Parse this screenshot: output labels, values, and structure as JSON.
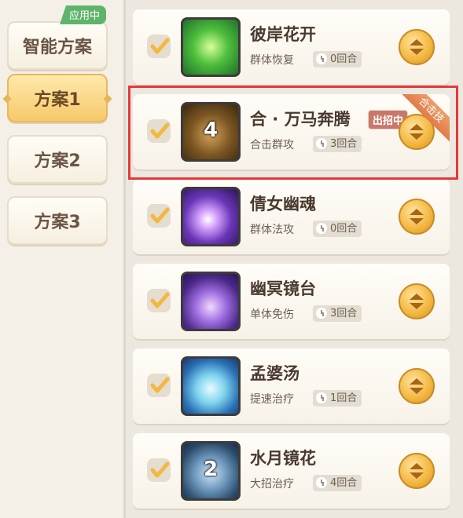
{
  "sidebar": {
    "plans": [
      {
        "label": "智能方案",
        "active": false,
        "badge": "应用中"
      },
      {
        "label": "方案1",
        "active": true
      },
      {
        "label": "方案2",
        "active": false
      },
      {
        "label": "方案3",
        "active": false
      }
    ]
  },
  "skills": [
    {
      "name": "彼岸花开",
      "type": "群体恢复",
      "rounds": "0回合",
      "icon": "green-flower-skill-icon",
      "colors": [
        "#2f8f3a",
        "#b7f07a"
      ]
    },
    {
      "name": "合 · 万马奔腾",
      "type": "合击群攻",
      "rounds": "3回合",
      "icon": "horse-stampede-skill-icon",
      "order": "4",
      "status": "出招中",
      "ribbon": "合击技",
      "colors": [
        "#5a3f1c",
        "#c99a52"
      ]
    },
    {
      "name": "倩女幽魂",
      "type": "群体法攻",
      "rounds": "0回合",
      "icon": "purple-spirit-skill-icon",
      "colors": [
        "#4b2a8a",
        "#e2b4ff"
      ]
    },
    {
      "name": "幽冥镜台",
      "type": "单体免伤",
      "rounds": "3回合",
      "icon": "ghost-mirror-skill-icon",
      "colors": [
        "#3c2270",
        "#c59af0"
      ]
    },
    {
      "name": "孟婆汤",
      "type": "提速治疗",
      "rounds": "1回合",
      "icon": "soup-bowl-skill-icon",
      "colors": [
        "#1d4f8e",
        "#93e0f4"
      ]
    },
    {
      "name": "水月镜花",
      "type": "大招治疗",
      "rounds": "4回合",
      "icon": "water-moon-skill-icon",
      "order": "2",
      "colors": [
        "#213e5c",
        "#8fb6d6"
      ]
    }
  ]
}
